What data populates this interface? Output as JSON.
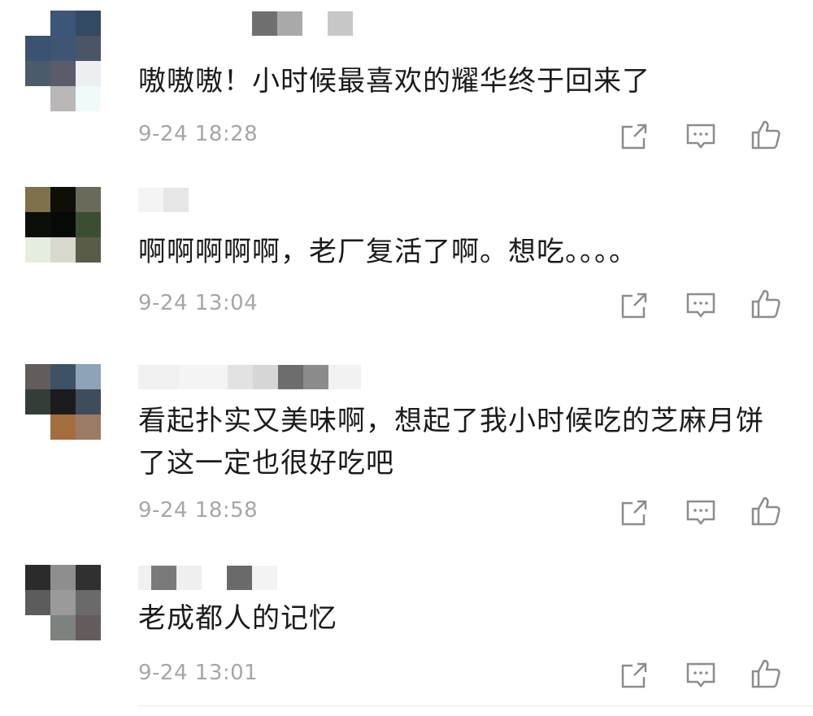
{
  "comments": [
    {
      "text": "嗷嗷嗷！小时候最喜欢的耀华终于回来了",
      "time": "9-24 18:28",
      "avatar_pixels": [
        "#ffffff",
        "#3c5678",
        "#334a63",
        "#3b5370",
        "#3e5674",
        "#4a5566",
        "#4b5b6c",
        "#5a5c6a",
        "#eceef2",
        "#ffffff",
        "#b9b7b8",
        "#f0fafa"
      ],
      "username_pixels": [
        "#6f6f6f",
        "#a9a9a9",
        "#ffffff",
        "#c7c7c7"
      ]
    },
    {
      "text": "啊啊啊啊啊，老厂复活了啊。想吃。。。。",
      "time": "9-24 13:04",
      "avatar_pixels": [
        "#7f714c",
        "#0e1008",
        "#6a6a5a",
        "#0c0e09",
        "#070a06",
        "#3b4e32",
        "#e4ede0",
        "#d9d8cc",
        "#585c48"
      ],
      "username_pixels": [
        "#f4f4f4",
        "#e6e6e6"
      ]
    },
    {
      "text": "看起扑实又美味啊，想起了我小时候吃的芝麻月饼了这一定也很好吃吧",
      "time": "9-24 18:58",
      "avatar_pixels": [
        "#625c5a",
        "#3e5266",
        "#8fa3b8",
        "#353d38",
        "#1a1c1e",
        "#3f4c5a",
        "#ffffff",
        "#a46d3c",
        "#9b7a66"
      ],
      "username_pixels": [
        "#e2e2e2",
        "#f4f4f4",
        "#d6d6d6",
        "#6d6d6d",
        "#8b8b8b",
        "#e8e8e8"
      ]
    },
    {
      "text": "老成都人的记忆",
      "time": "9-24 13:01",
      "avatar_pixels": [
        "#2b2b2b",
        "#8e8e8e",
        "#303030",
        "#5c5c5c",
        "#9a9a9a",
        "#6a6a6a",
        "#ffffff",
        "#7e827e",
        "#645c5c"
      ],
      "username_pixels": [
        "#7a7a7a",
        "#ffffff",
        "#6a6a6a"
      ]
    }
  ],
  "actions": [
    "share-icon",
    "comment-icon",
    "like-icon"
  ],
  "colors": {
    "text": "#1a1a1a",
    "time": "#a6a6a6",
    "icon": "#8c8c8c"
  }
}
